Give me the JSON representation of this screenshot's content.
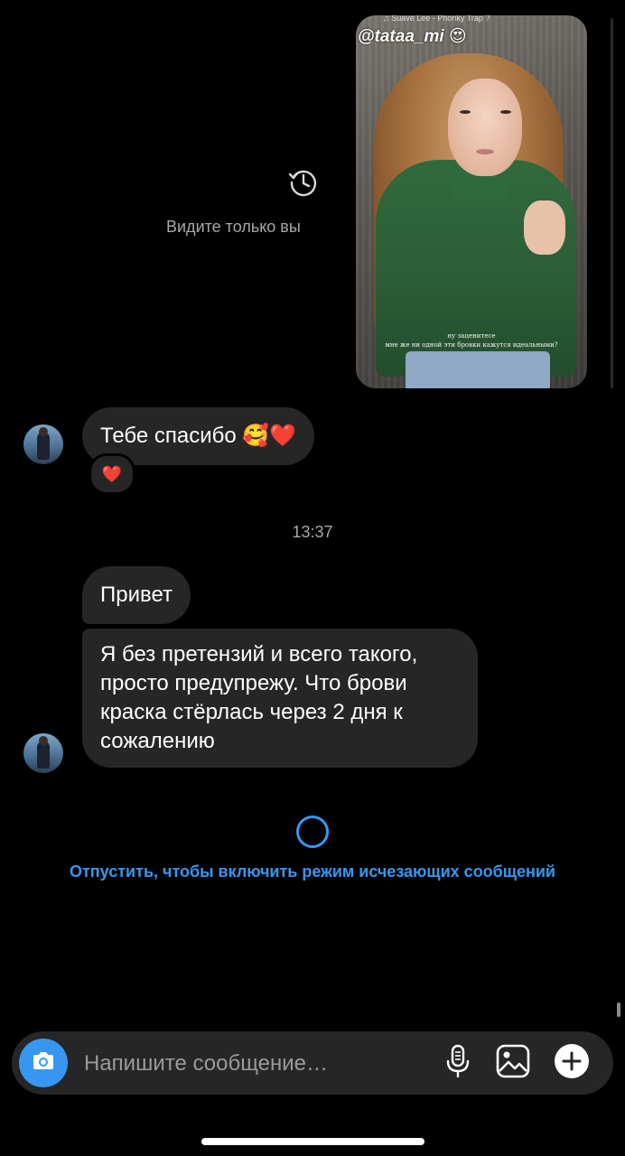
{
  "story": {
    "music_label": "Suave Lee - Phonky Trap ?",
    "mention": "@tataa_mi",
    "mention_emoji": "😍",
    "caption_line1": "ну заценитесе",
    "caption_line2": "мне же ни одной эти бровки кажутся идеальными?"
  },
  "story_notice": {
    "icon": "replay-clock-icon",
    "text": "Видите только вы"
  },
  "messages": [
    {
      "text": "Тебе спасибо 🥰❤️",
      "reaction": "❤️"
    },
    {
      "text": "Привет"
    },
    {
      "text": "Я без претензий и всего такого, просто предупрежу. Что брови краска стёрлась через 2 дня к сожалению"
    }
  ],
  "timestamp": "13:37",
  "vanish_mode": {
    "hint": "Отпустить, чтобы включить режим исчезающих сообщений"
  },
  "composer": {
    "placeholder": "Напишите сообщение…",
    "icons": [
      "camera-icon",
      "microphone-icon",
      "gallery-icon",
      "plus-icon"
    ]
  },
  "colors": {
    "background": "#000000",
    "bubble": "#262626",
    "accent": "#3897f0",
    "muted_text": "#a8a8a8"
  }
}
